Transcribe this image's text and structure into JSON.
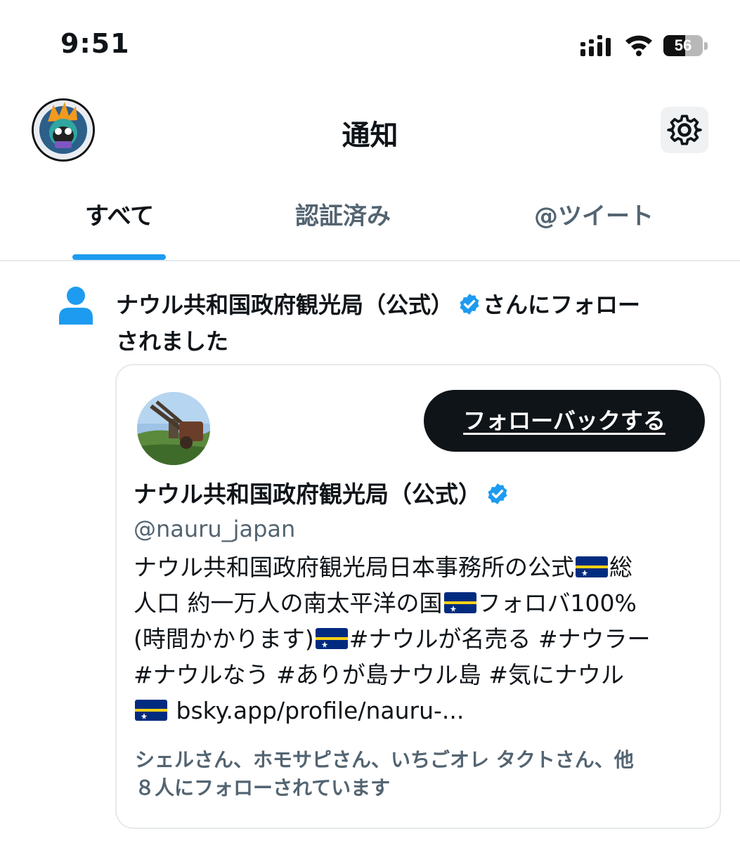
{
  "status_bar": {
    "time": "9:51",
    "battery_percent": "56",
    "battery_level": 0.56
  },
  "header": {
    "title": "通知",
    "settings_icon": "gear-icon",
    "avatar_icon": "user-avatar"
  },
  "tabs": [
    {
      "label": "すべて",
      "active": true
    },
    {
      "label": "認証済み",
      "active": false
    },
    {
      "label": "@ツイート",
      "active": false
    }
  ],
  "colors": {
    "accent": "#1d9bf0",
    "text_primary": "#0f1419",
    "text_secondary": "#536471",
    "button_dark": "#0f1419"
  },
  "notification": {
    "icon": "person-icon",
    "account_name": "ナウル共和国政府観光局（公式）",
    "action_text_1": "さんにフォロー",
    "action_text_2": "されました",
    "card": {
      "follow_back_label": "フォローバックする",
      "name": "ナウル共和国政府観光局（公式）",
      "handle": "@nauru_japan",
      "bio_lines": [
        "ナウル共和国政府観光局日本事務所の公式",
        "総",
        "人口 約一万人の南太平洋の国",
        "フォロバ100%",
        "(時間かかります)",
        "#ナウルが名売る #ナウラー",
        "#ナウルなう #ありが島ナウル島 #気にナウル",
        "bsky.app/profile/nauru-..."
      ],
      "followed_by_1": "シェルさん、ホモサピさん、いちごオレ タクトさん、他",
      "followed_by_2": "８人にフォローされています"
    }
  }
}
